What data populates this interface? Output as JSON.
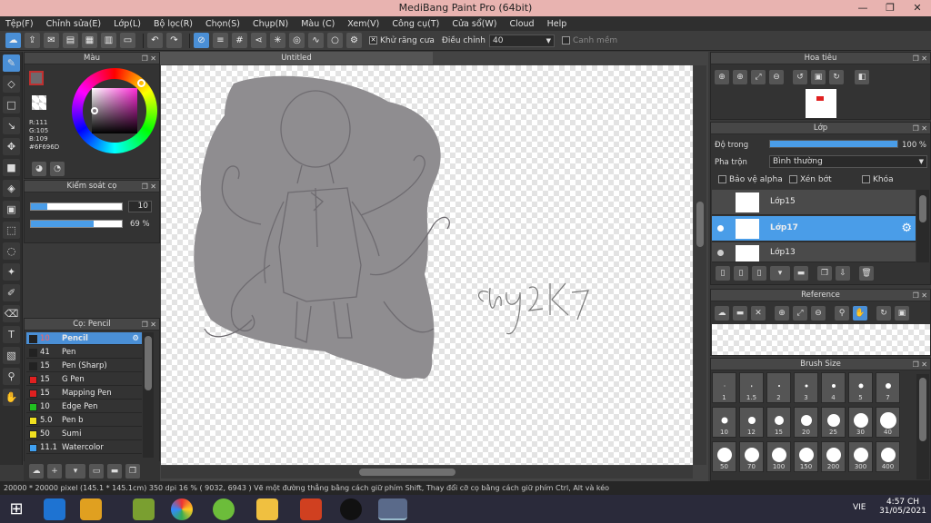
{
  "window": {
    "title": "MediBang Paint Pro (64bit)",
    "minimize": "—",
    "maximize": "❐",
    "close": "✕"
  },
  "menu": [
    "Tệp(F)",
    "Chỉnh sửa(E)",
    "Lớp(L)",
    "Bộ lọc(R)",
    "Chọn(S)",
    "Chụp(N)",
    "Màu (C)",
    "Xem(V)",
    "Công cụ(T)",
    "Cửa sổ(W)",
    "Cloud",
    "Help"
  ],
  "toolbar": {
    "antialias_label": "Khử răng cưa",
    "antialias_checked": "✕",
    "adjust_label": "Điều chỉnh",
    "adjust_value": "40",
    "smooth_label": "Canh mềm"
  },
  "color_panel": {
    "title": "Màu",
    "r": "R:111",
    "g": "G:105",
    "b": "B:109",
    "hex": "#6F696D",
    "current_color": "#6f696d",
    "secondary_color": "#ffffff"
  },
  "brush_control": {
    "title": "Kiểm soát cọ",
    "size_value": "10",
    "opacity_value": "69 %",
    "size_fraction": 0.18,
    "opacity_fraction": 0.69
  },
  "brush_panel": {
    "title": "Cọ: Pencil",
    "items": [
      {
        "size": "10",
        "name": "Pencil",
        "color": "#222222",
        "selected": true
      },
      {
        "size": "41",
        "name": "Pen",
        "color": "#222222"
      },
      {
        "size": "15",
        "name": "Pen (Sharp)",
        "color": "#222222"
      },
      {
        "size": "15",
        "name": "G Pen",
        "color": "#e02020"
      },
      {
        "size": "15",
        "name": "Mapping Pen",
        "color": "#e02020"
      },
      {
        "size": "10",
        "name": "Edge Pen",
        "color": "#20c020"
      },
      {
        "size": "5.0",
        "name": "Pen b",
        "color": "#f0e020"
      },
      {
        "size": "50",
        "name": "Sumi",
        "color": "#f0e020"
      },
      {
        "size": "11.1",
        "name": "Watercolor",
        "color": "#40a0f0"
      }
    ]
  },
  "canvas": {
    "tab": "Untitled",
    "signature": "chg2k7"
  },
  "navigator": {
    "title": "Hoa tiêu"
  },
  "layer_panel": {
    "title": "Lớp",
    "opacity_label": "Độ trong",
    "opacity_value": "100 %",
    "opacity_fraction": 1.0,
    "blend_label": "Pha trộn",
    "blend_value": "Bình thường",
    "protect_alpha": "Bảo vệ alpha",
    "clipping": "Xén bớt",
    "lock": "Khóa",
    "layers": [
      {
        "name": "Lớp15"
      },
      {
        "name": "Lớp17",
        "selected": true
      },
      {
        "name": "Lớp13"
      }
    ]
  },
  "reference": {
    "title": "Reference"
  },
  "brush_size": {
    "title": "Brush Size",
    "sizes": [
      "1",
      "1.5",
      "2",
      "3",
      "4",
      "5",
      "7",
      "10",
      "12",
      "15",
      "20",
      "25",
      "30",
      "40",
      "50",
      "70",
      "100",
      "150",
      "200",
      "300",
      "400"
    ]
  },
  "status": {
    "text": "20000 * 20000 pixel  (145.1 * 145.1cm)  350 dpi  16 %  ( 9032, 6943 )  Vẽ một đường thẳng bằng cách giữ phím Shift, Thay đổi cỡ cọ bằng cách giữ phím Ctrl, Alt và kéo"
  },
  "taskbar": {
    "lang": "VIE",
    "time": "4:57 CH",
    "date": "31/05/2021"
  }
}
